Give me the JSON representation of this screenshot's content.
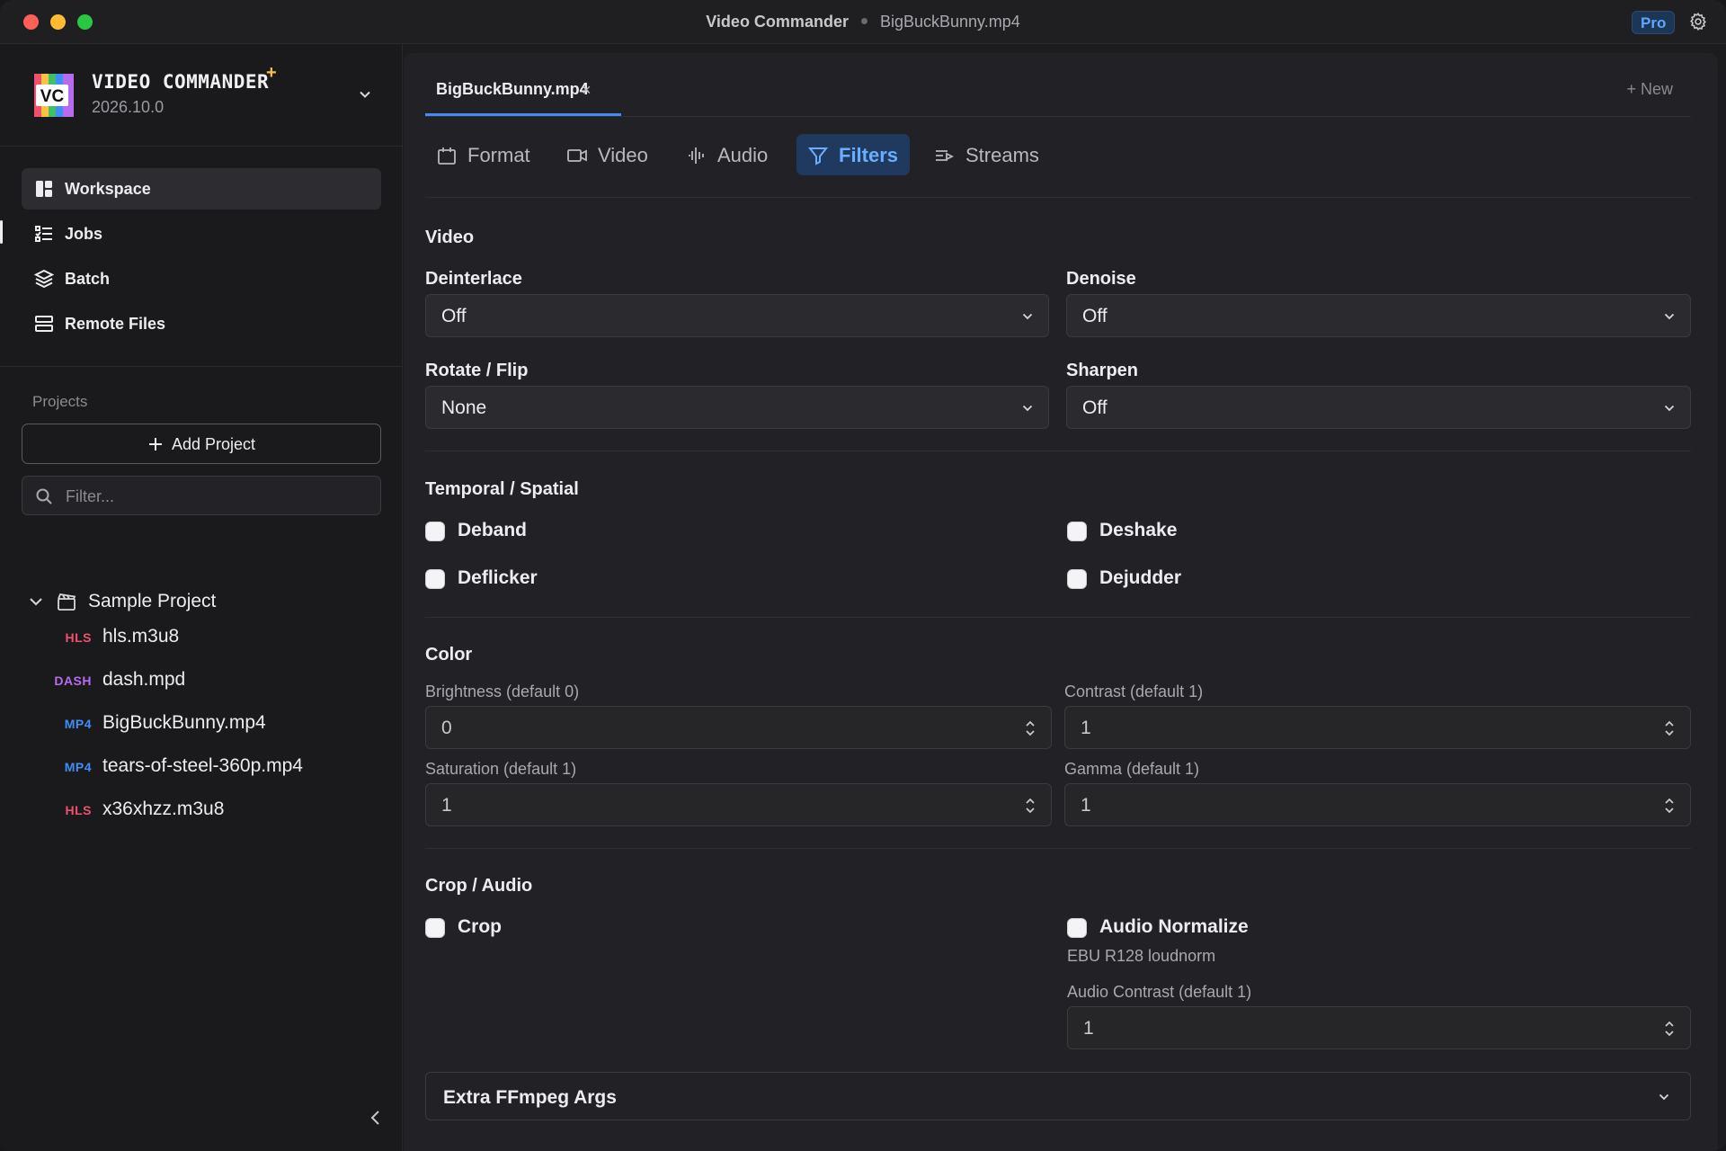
{
  "titlebar": {
    "app": "Video Commander",
    "file": "BigBuckBunny.mp4",
    "badge": "Pro",
    "settings_icon": "gear-icon"
  },
  "sidebar": {
    "app_name": "VIDEO COMMANDER",
    "version": "2026.10.0",
    "nav": [
      {
        "label": "Workspace",
        "icon": "workspace-icon",
        "active": true
      },
      {
        "label": "Jobs",
        "icon": "jobs-list-icon"
      },
      {
        "label": "Batch",
        "icon": "layers-icon"
      },
      {
        "label": "Remote Files",
        "icon": "server-icon"
      }
    ],
    "projects_label": "Projects",
    "add_project": "Add Project",
    "filter_placeholder": "Filter...",
    "project": {
      "name": "Sample Project",
      "expanded": true
    },
    "files": [
      {
        "type": "HLS",
        "name": "hls.m3u8",
        "color": "#f0506e"
      },
      {
        "type": "DASH",
        "name": "dash.mpd",
        "color": "#b76cf0"
      },
      {
        "type": "MP4",
        "name": "BigBuckBunny.mp4",
        "color": "#3f8ef5"
      },
      {
        "type": "MP4",
        "name": "tears-of-steel-360p.mp4",
        "color": "#3f8ef5"
      },
      {
        "type": "HLS",
        "name": "x36xhzz.m3u8",
        "color": "#f0506e"
      }
    ]
  },
  "main": {
    "file_tab": {
      "label": "BigBuckBunny.mp4",
      "close": "×"
    },
    "new_button": "+ New",
    "subtabs": [
      {
        "label": "Format",
        "icon": "calendar-icon"
      },
      {
        "label": "Video",
        "icon": "video-camera-icon"
      },
      {
        "label": "Audio",
        "icon": "audio-waveform-icon"
      },
      {
        "label": "Filters",
        "icon": "filter-icon",
        "active": true
      },
      {
        "label": "Streams",
        "icon": "streams-icon"
      }
    ],
    "video": {
      "title": "Video",
      "deinterlace": {
        "label": "Deinterlace",
        "value": "Off"
      },
      "denoise": {
        "label": "Denoise",
        "value": "Off"
      },
      "rotate": {
        "label": "Rotate / Flip",
        "value": "None"
      },
      "sharpen": {
        "label": "Sharpen",
        "value": "Off"
      }
    },
    "temporal": {
      "title": "Temporal / Spatial",
      "deband": {
        "label": "Deband",
        "checked": false
      },
      "deshake": {
        "label": "Deshake",
        "checked": false
      },
      "deflicker": {
        "label": "Deflicker",
        "checked": false
      },
      "dejudder": {
        "label": "Dejudder",
        "checked": false
      }
    },
    "color": {
      "title": "Color",
      "brightness": {
        "label": "Brightness (default 0)",
        "value": "0"
      },
      "contrast": {
        "label": "Contrast (default 1)",
        "value": "1"
      },
      "saturation": {
        "label": "Saturation (default 1)",
        "value": "1"
      },
      "gamma": {
        "label": "Gamma (default 1)",
        "value": "1"
      }
    },
    "crop_audio": {
      "title": "Crop / Audio",
      "crop": {
        "label": "Crop",
        "checked": false
      },
      "normalize": {
        "label": "Audio Normalize",
        "checked": false,
        "hint": "EBU R128 loudnorm"
      },
      "audio_contrast": {
        "label": "Audio Contrast (default 1)",
        "value": "1"
      }
    },
    "extra": {
      "label": "Extra FFmpeg Args"
    }
  }
}
